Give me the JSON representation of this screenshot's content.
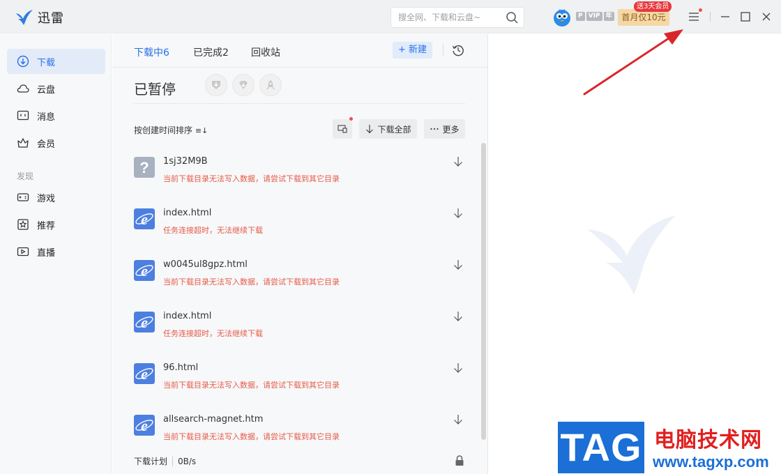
{
  "app": {
    "title": "迅雷"
  },
  "search": {
    "placeholder": "搜全网、下载和云盘~"
  },
  "account": {
    "vip_p": "P",
    "vip_label": "VIP",
    "vip_year": "年",
    "promo_label": "首月仅10元",
    "promo_tag": "送3天会员"
  },
  "sidebar": {
    "items": [
      {
        "label": "下载",
        "icon": "download-icon"
      },
      {
        "label": "云盘",
        "icon": "cloud-icon"
      },
      {
        "label": "消息",
        "icon": "message-icon"
      },
      {
        "label": "会员",
        "icon": "crown-icon"
      }
    ],
    "section": "发现",
    "discover": [
      {
        "label": "游戏",
        "icon": "gamepad-icon"
      },
      {
        "label": "推荐",
        "icon": "star-icon"
      },
      {
        "label": "直播",
        "icon": "live-icon"
      }
    ]
  },
  "tabs": [
    {
      "label": "下载中6"
    },
    {
      "label": "已完成2"
    },
    {
      "label": "回收站"
    }
  ],
  "toolbar": {
    "new_label": "新建",
    "new_prefix": "+"
  },
  "panel": {
    "section_title": "已暂停",
    "sort_label": "按创建时间排序",
    "download_all": "下载全部",
    "more": "更多"
  },
  "downloads": [
    {
      "name": "1sj32M9B",
      "error": "当前下载目录无法写入数据，请尝试下载到其它目录",
      "icon": "unknown-file-icon"
    },
    {
      "name": "index.html",
      "error": "任务连接超时，无法继续下载",
      "icon": "ie-file-icon"
    },
    {
      "name": "w0045ul8gpz.html",
      "error": "当前下载目录无法写入数据，请尝试下载到其它目录",
      "icon": "ie-file-icon"
    },
    {
      "name": "index.html",
      "error": "任务连接超时，无法继续下载",
      "icon": "ie-file-icon"
    },
    {
      "name": "96.html",
      "error": "当前下载目录无法写入数据，请尝试下载到其它目录",
      "icon": "ie-file-icon"
    },
    {
      "name": "allsearch-magnet.htm",
      "error": "当前下载目录无法写入数据，请尝试下载到其它目录",
      "icon": "ie-file-icon"
    }
  ],
  "footer": {
    "plan": "下载计划",
    "speed": "0B/s"
  },
  "watermark": {
    "tag": "TAG",
    "cn": "电脑技术网",
    "url": "www.tagxp.com"
  },
  "colors": {
    "accent": "#2670e8",
    "error": "#e55b4a",
    "annotation_arrow": "#d9262b"
  }
}
